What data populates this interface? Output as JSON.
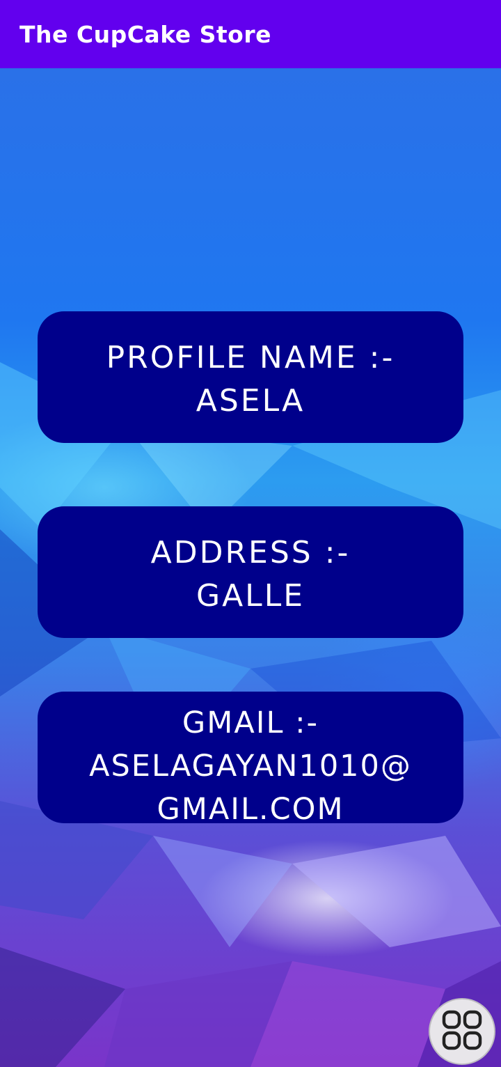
{
  "app": {
    "title": "The CupCake Store"
  },
  "profile": {
    "name_label": "PROFILE NAME :-",
    "name_value": "ASELA",
    "address_label": "ADDRESS :-",
    "address_value": "GALLE",
    "gmail_label": "GMAIL :-",
    "gmail_value_line1": "ASELAGAYAN1010@",
    "gmail_value_line2": "GMAIL.COM"
  },
  "floating_button": {
    "icon": "grid-icon"
  },
  "colors": {
    "appbar": "#6200ee",
    "card": "#00008b",
    "text": "#ffffff"
  }
}
